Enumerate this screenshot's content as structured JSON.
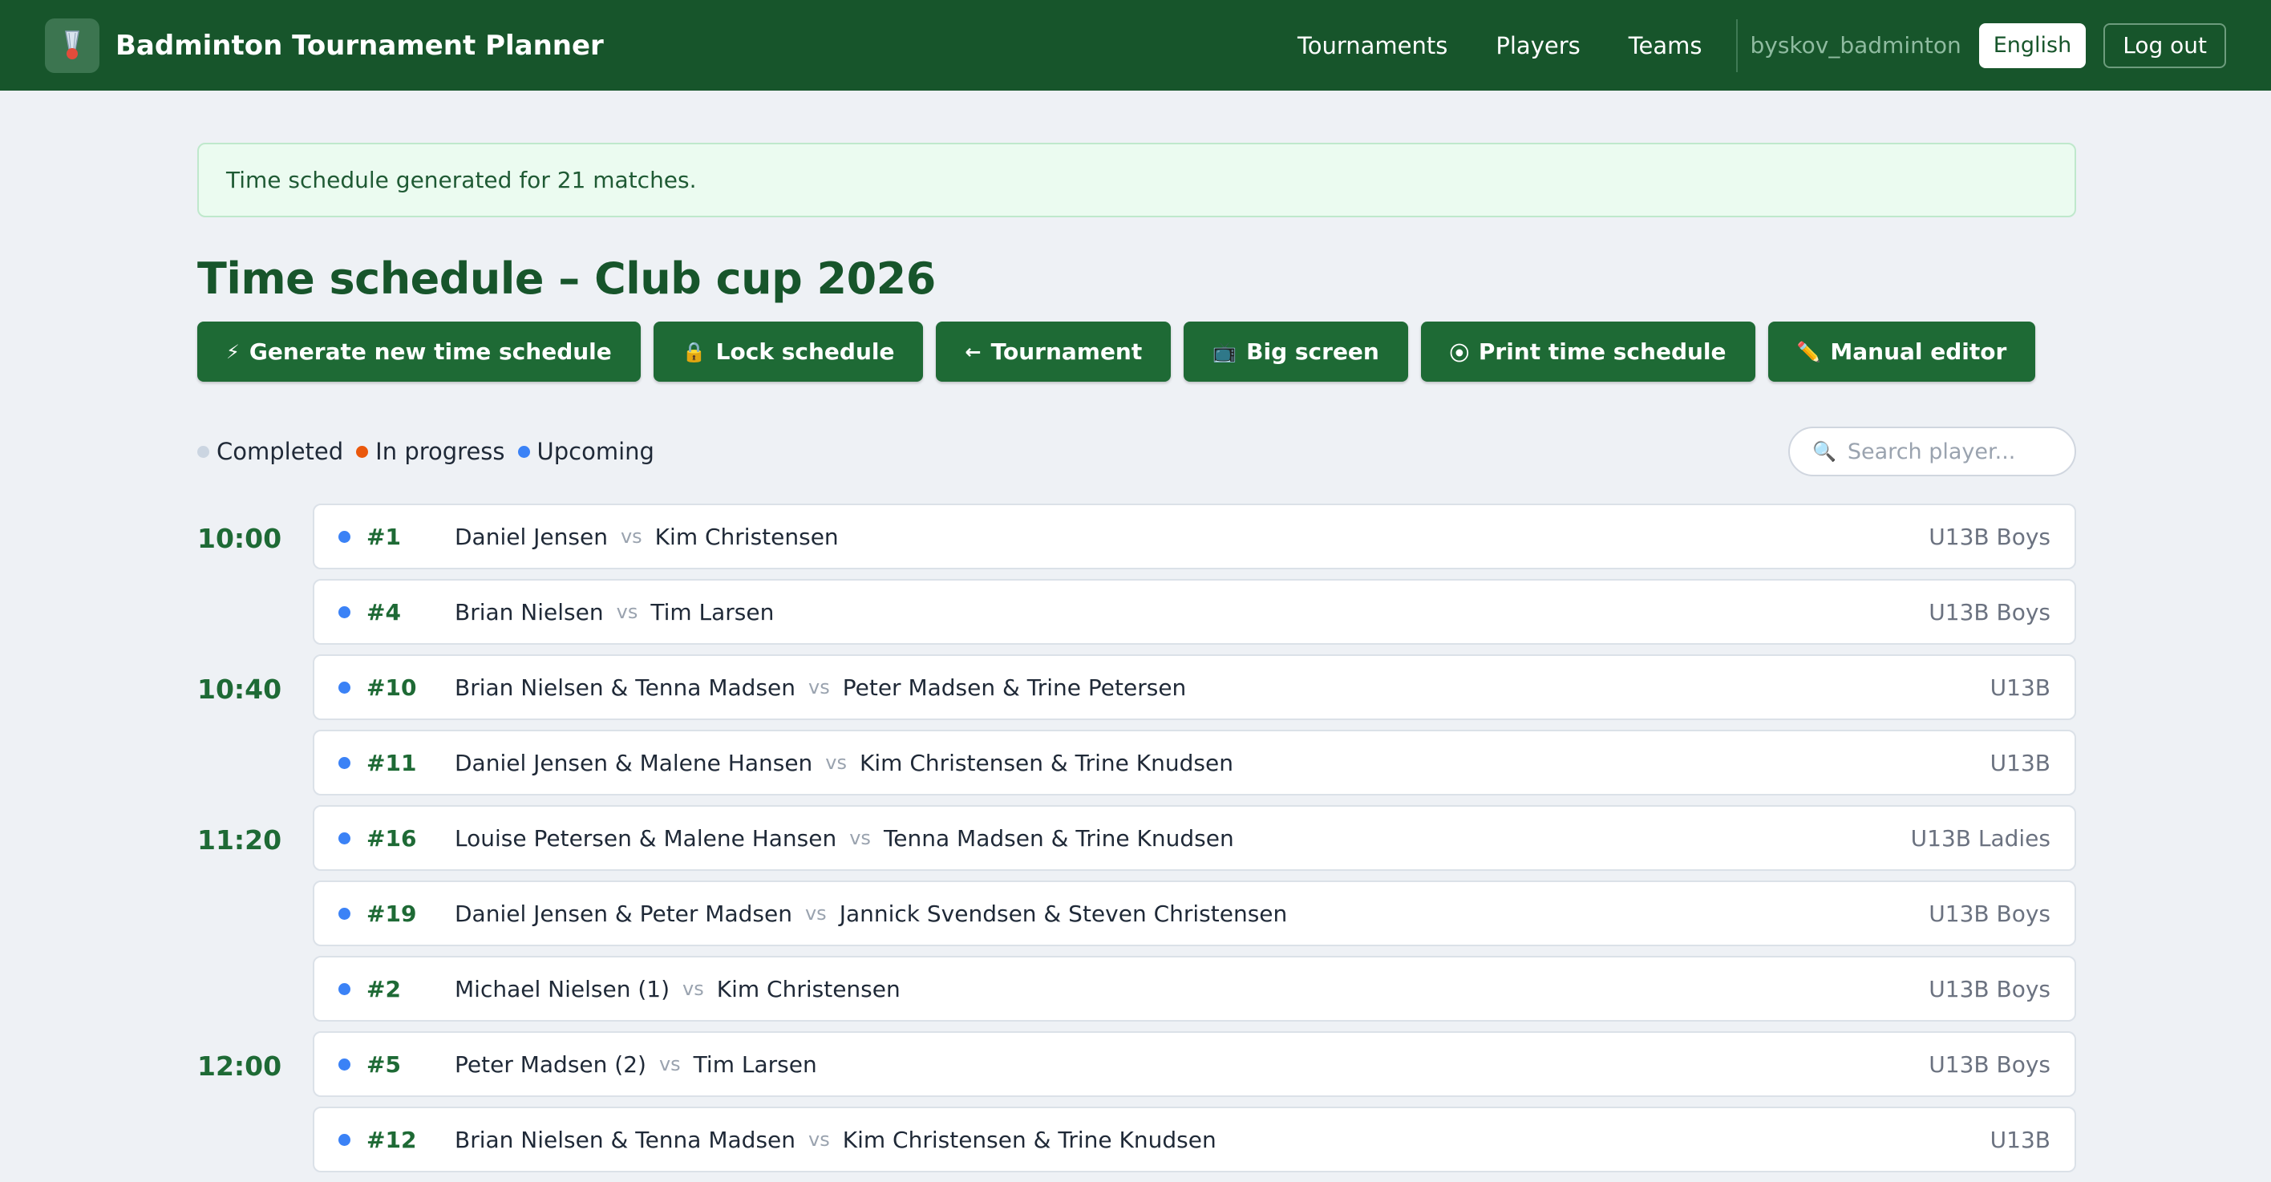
{
  "header": {
    "app_title": "Badminton Tournament Planner",
    "nav": [
      "Tournaments",
      "Players",
      "Teams"
    ],
    "username": "byskov_badminton",
    "language": "English",
    "logout": "Log out"
  },
  "alert": "Time schedule generated for 21 matches.",
  "page_title": "Time schedule – Club cup 2026",
  "actions": [
    {
      "icon": "⚡",
      "label": "Generate new time schedule"
    },
    {
      "icon": "🔒",
      "label": "Lock schedule"
    },
    {
      "icon": "←",
      "label": "Tournament"
    },
    {
      "icon": "📺",
      "label": "Big screen"
    },
    {
      "icon": "⦿",
      "label": "Print time schedule"
    },
    {
      "icon": "✏️",
      "label": "Manual editor"
    }
  ],
  "legend": [
    {
      "label": "Completed",
      "color": "#cbd5e1"
    },
    {
      "label": "In progress",
      "color": "#ea580c"
    },
    {
      "label": "Upcoming",
      "color": "#3b82f6"
    }
  ],
  "search_placeholder": "Search player...",
  "vs_label": "vs",
  "slots": [
    {
      "time": "10:00",
      "matches": [
        {
          "num": "#1",
          "p1": "Daniel Jensen",
          "p2": "Kim Christensen",
          "cat": "U13B Boys"
        },
        {
          "num": "#4",
          "p1": "Brian Nielsen",
          "p2": "Tim Larsen",
          "cat": "U13B Boys"
        }
      ]
    },
    {
      "time": "10:40",
      "matches": [
        {
          "num": "#10",
          "p1": "Brian Nielsen & Tenna Madsen",
          "p2": "Peter Madsen & Trine Petersen",
          "cat": "U13B"
        },
        {
          "num": "#11",
          "p1": "Daniel Jensen & Malene Hansen",
          "p2": "Kim Christensen & Trine Knudsen",
          "cat": "U13B"
        }
      ]
    },
    {
      "time": "11:20",
      "matches": [
        {
          "num": "#16",
          "p1": "Louise Petersen & Malene Hansen",
          "p2": "Tenna Madsen & Trine Knudsen",
          "cat": "U13B Ladies"
        },
        {
          "num": "#19",
          "p1": "Daniel Jensen & Peter Madsen",
          "p2": "Jannick Svendsen & Steven Christensen",
          "cat": "U13B Boys"
        },
        {
          "num": "#2",
          "p1": "Michael Nielsen (1)",
          "p2": "Kim Christensen",
          "cat": "U13B Boys"
        }
      ]
    },
    {
      "time": "12:00",
      "matches": [
        {
          "num": "#5",
          "p1": "Peter Madsen (2)",
          "p2": "Tim Larsen",
          "cat": "U13B Boys"
        },
        {
          "num": "#12",
          "p1": "Brian Nielsen & Tenna Madsen",
          "p2": "Kim Christensen & Trine Knudsen",
          "cat": "U13B"
        }
      ]
    }
  ]
}
